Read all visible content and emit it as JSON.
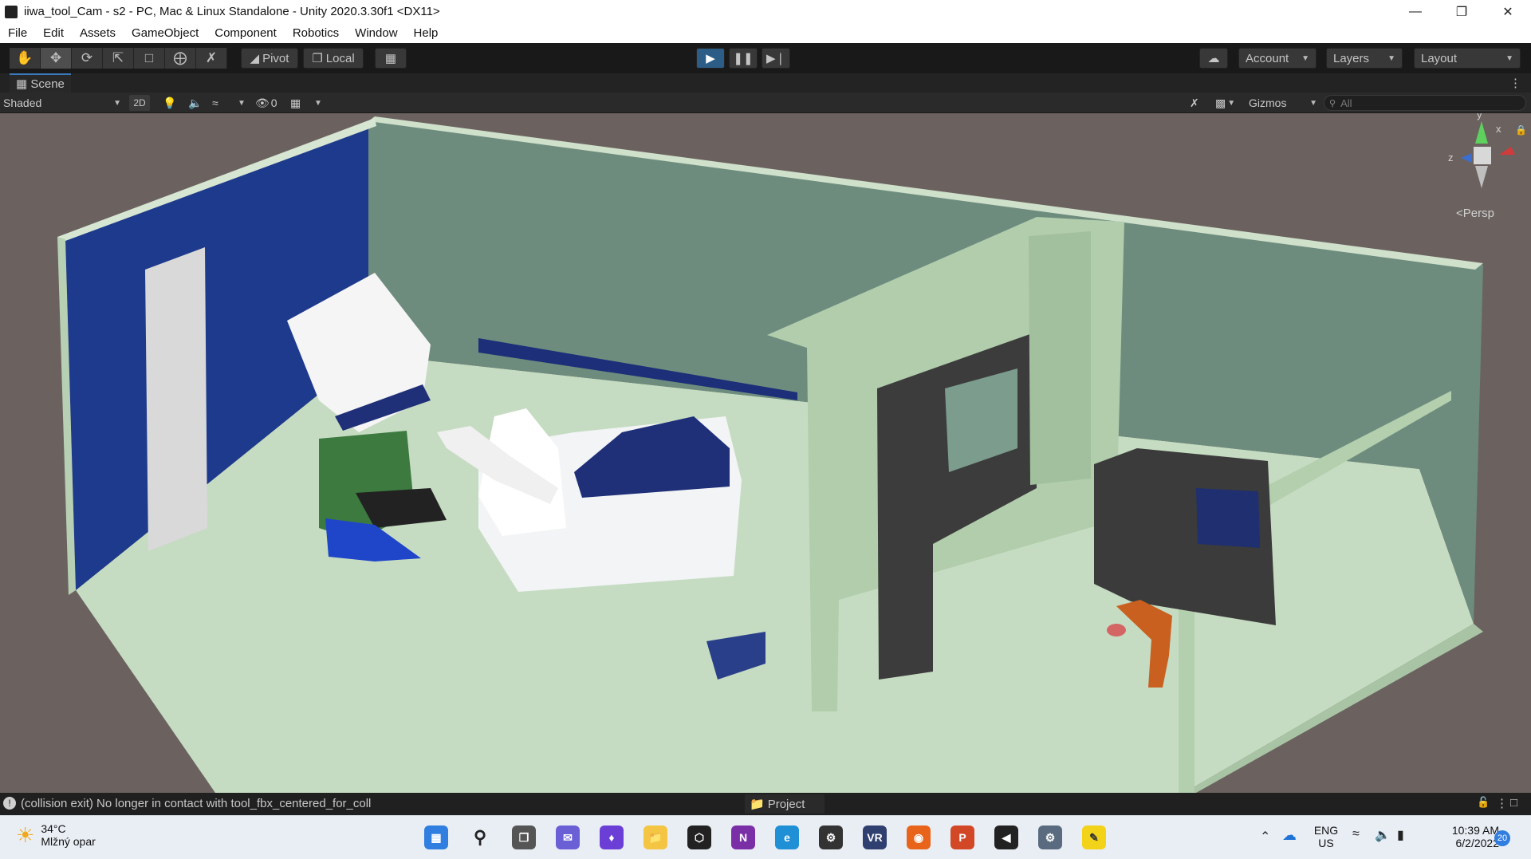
{
  "window": {
    "title": "iiwa_tool_Cam - s2 - PC, Mac & Linux Standalone - Unity 2020.3.30f1 <DX11>"
  },
  "menu": [
    "File",
    "Edit",
    "Assets",
    "GameObject",
    "Component",
    "Robotics",
    "Window",
    "Help"
  ],
  "toolbar": {
    "pivot_label": "Pivot",
    "local_label": "Local",
    "account_label": "Account",
    "layers_label": "Layers",
    "layout_label": "Layout"
  },
  "scene": {
    "tab_label": "Scene",
    "shading_mode": "Shaded",
    "mode_2d": "2D",
    "hidden_count": "0",
    "gizmos_label": "Gizmos",
    "search_placeholder": "All",
    "persp_label": "Persp",
    "axis_y": "y",
    "axis_x": "x",
    "axis_z": "z"
  },
  "status": {
    "message": "(collision exit) No longer in contact with  tool_fbx_centered_for_coll",
    "project_tab": "Project"
  },
  "taskbar": {
    "weather_temp": "34°C",
    "weather_desc": "Mlžný opar",
    "lang_line1": "ENG",
    "lang_line2": "US",
    "time": "10:39 AM",
    "date": "6/2/2022",
    "notifications": "20"
  },
  "colors": {
    "play_blue": "#2c5d87",
    "wall_blue": "#1f3a8a",
    "floor": "#cfe3cb",
    "wall": "#a9c5a5",
    "sky": "#6b625f"
  }
}
